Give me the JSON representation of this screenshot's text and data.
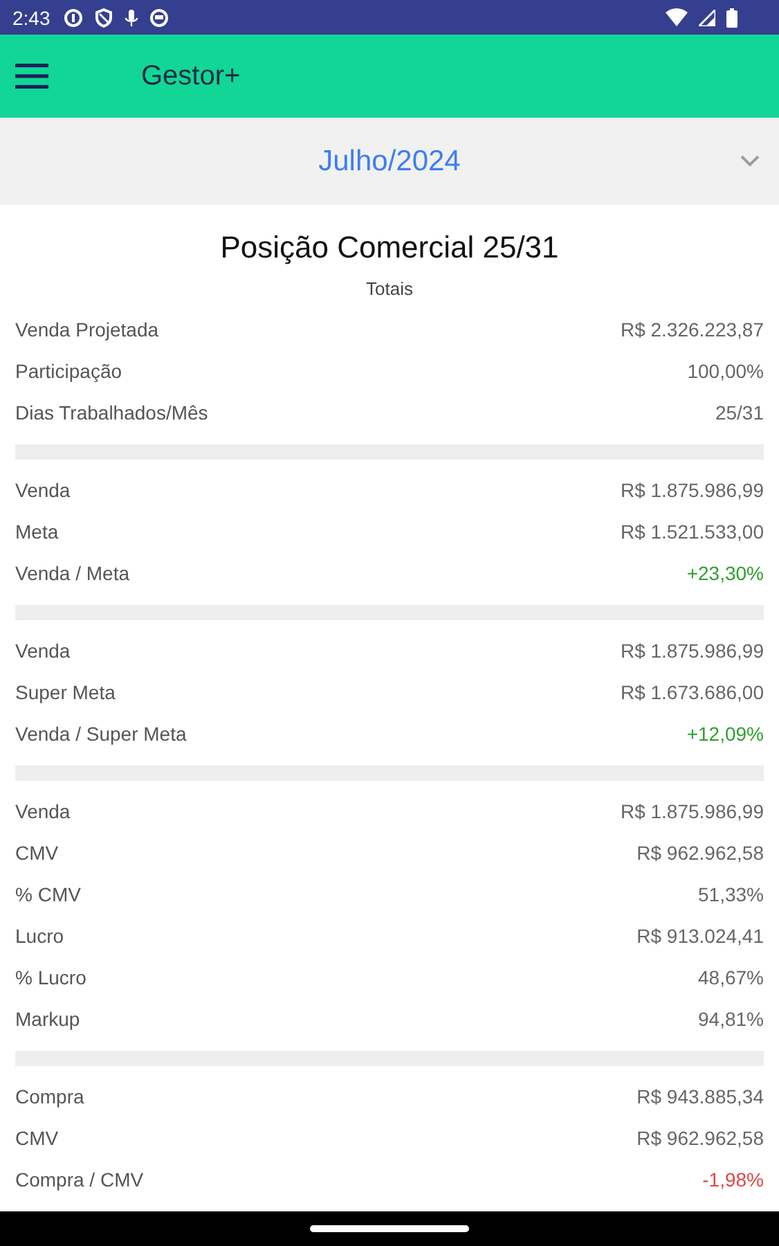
{
  "status_bar": {
    "time": "2:43"
  },
  "app_bar": {
    "title": "Gestor+"
  },
  "period_selector": {
    "value": "Julho/2024"
  },
  "report": {
    "title": "Posição Comercial 25/31",
    "subtitle": "Totais",
    "sections": [
      {
        "rows": [
          {
            "label": "Venda Projetada",
            "value": "R$ 2.326.223,87",
            "color": "#666666"
          },
          {
            "label": "Participação",
            "value": "100,00%",
            "color": "#666666"
          },
          {
            "label": "Dias Trabalhados/Mês",
            "value": "25/31",
            "color": "#666666"
          }
        ]
      },
      {
        "rows": [
          {
            "label": "Venda",
            "value": "R$ 1.875.986,99",
            "color": "#666666"
          },
          {
            "label": "Meta",
            "value": "R$ 1.521.533,00",
            "color": "#666666"
          },
          {
            "label": "Venda / Meta",
            "value": "+23,30%",
            "color": "#2ea02e"
          }
        ]
      },
      {
        "rows": [
          {
            "label": "Venda",
            "value": "R$ 1.875.986,99",
            "color": "#666666"
          },
          {
            "label": "Super Meta",
            "value": "R$ 1.673.686,00",
            "color": "#666666"
          },
          {
            "label": "Venda / Super Meta",
            "value": "+12,09%",
            "color": "#2ea02e"
          }
        ]
      },
      {
        "rows": [
          {
            "label": "Venda",
            "value": "R$ 1.875.986,99",
            "color": "#666666"
          },
          {
            "label": "CMV",
            "value": "R$ 962.962,58",
            "color": "#666666"
          },
          {
            "label": "% CMV",
            "value": "51,33%",
            "color": "#666666"
          },
          {
            "label": "Lucro",
            "value": "R$ 913.024,41",
            "color": "#666666"
          },
          {
            "label": "% Lucro",
            "value": "48,67%",
            "color": "#666666"
          },
          {
            "label": "Markup",
            "value": "94,81%",
            "color": "#666666"
          }
        ]
      },
      {
        "rows": [
          {
            "label": "Compra",
            "value": "R$ 943.885,34",
            "color": "#666666"
          },
          {
            "label": "CMV",
            "value": "R$ 962.962,58",
            "color": "#666666"
          },
          {
            "label": "Compra / CMV",
            "value": "-1,98%",
            "color": "#e04444"
          }
        ]
      }
    ]
  }
}
